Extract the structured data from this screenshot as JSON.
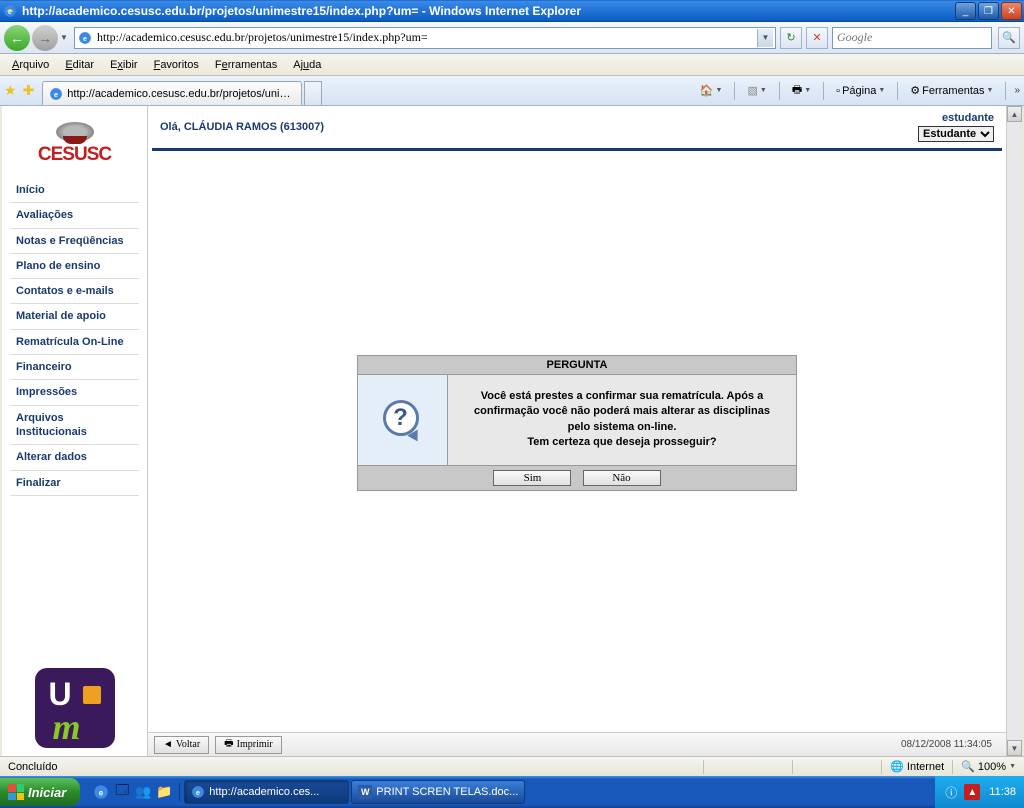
{
  "window": {
    "title": "http://academico.cesusc.edu.br/projetos/unimestre15/index.php?um= - Windows Internet Explorer",
    "url": "http://academico.cesusc.edu.br/projetos/unimestre15/index.php?um="
  },
  "search": {
    "placeholder": "Google"
  },
  "menu": {
    "arquivo": "Arquivo",
    "editar": "Editar",
    "exibir": "Exibir",
    "favoritos": "Favoritos",
    "ferramentas": "Ferramentas",
    "ajuda": "Ajuda"
  },
  "tab": {
    "title": "http://academico.cesusc.edu.br/projetos/unimestre1..."
  },
  "toolbar": {
    "pagina": "Página",
    "ferramentas": "Ferramentas"
  },
  "logo": "CESUSC",
  "sidebar": {
    "items": [
      "Início",
      "Avaliações",
      "Notas e Freqüências",
      "Plano de ensino",
      "Contatos e e-mails",
      "Material de apoio",
      "Rematrícula On-Line",
      "Financeiro",
      "Impressões",
      "Arquivos Institucionais",
      "Alterar dados",
      "Finalizar"
    ]
  },
  "header": {
    "greeting": "Olá, CLÁUDIA RAMOS (613007)",
    "role_label": "estudante",
    "role_selected": "Estudante"
  },
  "dialog": {
    "title": "PERGUNTA",
    "line1": "Você está prestes a confirmar sua rematrícula. Após a confirmação você não poderá mais alterar as disciplinas pelo sistema on-line.",
    "line2": "Tem certeza que deseja prosseguir?",
    "yes": "Sim",
    "no": "Não"
  },
  "footer": {
    "back": "Voltar",
    "print": "Imprimir",
    "timestamp": "08/12/2008 11:34:05"
  },
  "status": {
    "text": "Concluído",
    "zone": "Internet",
    "zoom": "100%"
  },
  "taskbar": {
    "start": "Iniciar",
    "items": [
      "http://academico.ces...",
      "PRINT SCREN TELAS.doc..."
    ],
    "clock": "11:38"
  }
}
